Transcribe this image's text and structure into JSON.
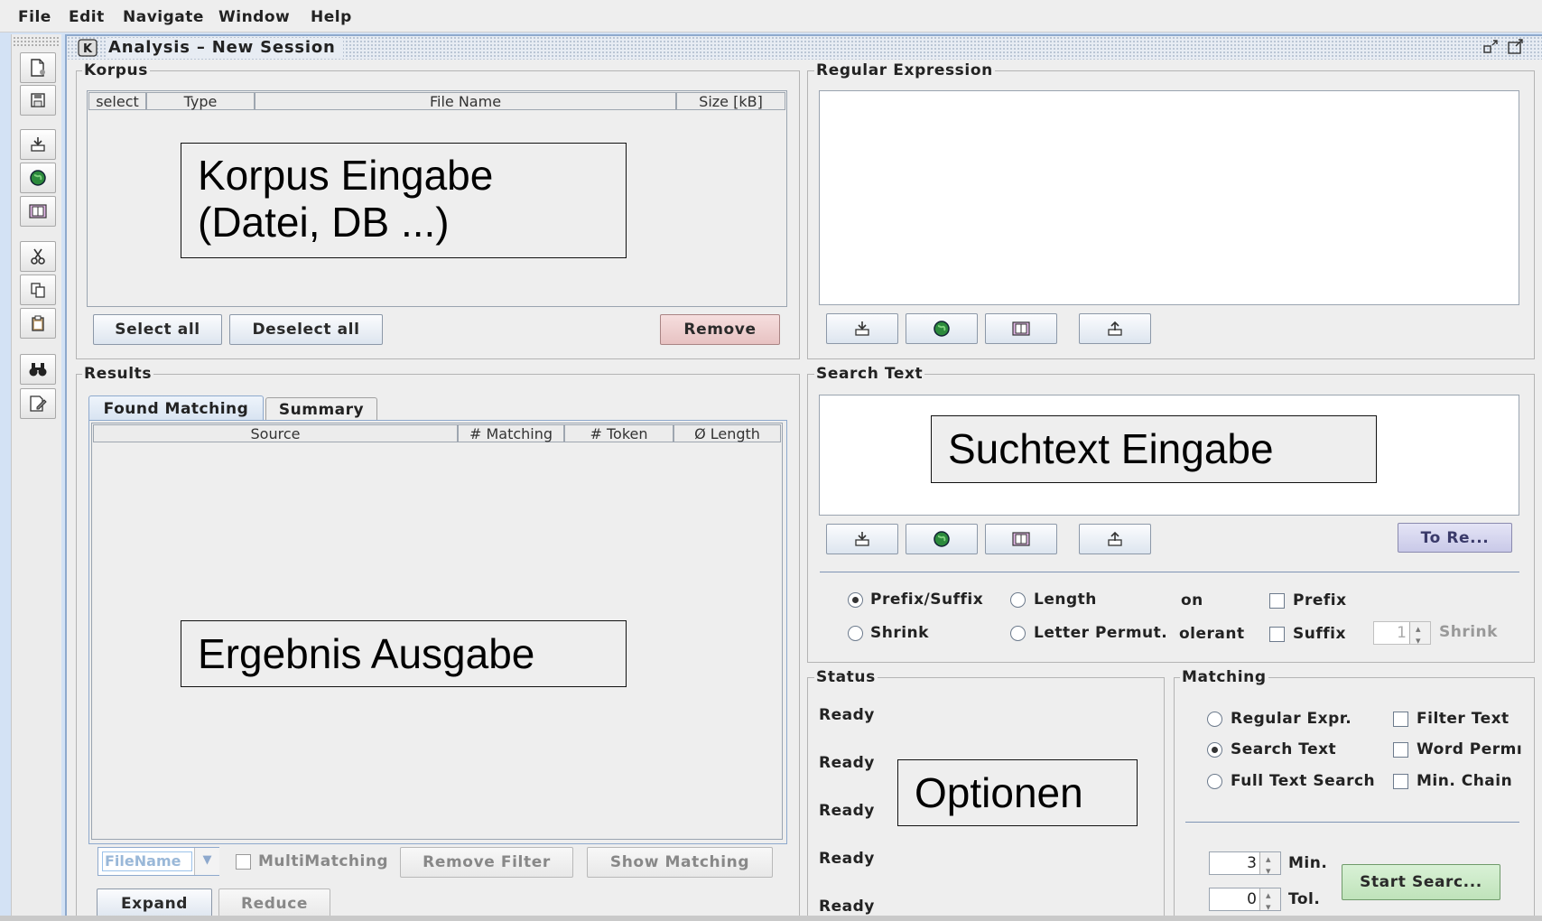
{
  "menu": [
    "File",
    "Edit",
    "Navigate",
    "Window",
    "Help"
  ],
  "toolbar_icons": [
    "new-document-icon",
    "save-icon",
    "import-icon",
    "globe-icon",
    "book-icon",
    "cut-icon",
    "copy-icon",
    "paste-icon",
    "binoculars-icon",
    "edit-icon"
  ],
  "window": {
    "title": "Analysis – New Session"
  },
  "korpus": {
    "title": "Korpus",
    "columns": [
      "select",
      "Type",
      "File Name",
      "Size [kB]"
    ],
    "annotation": [
      "Korpus Eingabe",
      "(Datei, DB ...)"
    ],
    "buttons": {
      "select_all": "Select all",
      "deselect_all": "Deselect all",
      "remove": "Remove"
    }
  },
  "regex": {
    "title": "Regular Expression"
  },
  "results": {
    "title": "Results",
    "tabs": [
      "Found Matching",
      "Summary"
    ],
    "columns": [
      "Source",
      "# Matching",
      "# Token",
      "Ø Length"
    ],
    "annotation": "Ergebnis Ausgabe",
    "filter_placeholder": "FileName",
    "multimatching": "MultiMatching",
    "remove_filter": "Remove Filter",
    "show_matching": "Show Matching",
    "expand": "Expand",
    "reduce": "Reduce"
  },
  "search": {
    "title": "Search Text",
    "annotation": "Suchtext Eingabe",
    "to_regex": "To Re...",
    "options": {
      "prefix_suffix": "Prefix/Suffix",
      "length": "Length",
      "on": "on",
      "prefix": "Prefix",
      "shrink": "Shrink",
      "letter_permut": "Letter Permut.",
      "olerant": "olerant",
      "suffix": "Suffix",
      "shrink_value": "1",
      "shrink_label": "Shrink"
    }
  },
  "status": {
    "title": "Status",
    "lines": [
      "Ready",
      "Ready",
      "Ready",
      "Ready",
      "Ready"
    ],
    "annotation": "Optionen"
  },
  "matching": {
    "title": "Matching",
    "regular_expr": "Regular Expr.",
    "search_text": "Search Text",
    "full_text": "Full Text Search",
    "filter_text": "Filter Text",
    "word_perm": "Word Permı",
    "min_chain": "Min. Chain",
    "min_value": "3",
    "min_label": "Min.",
    "tol_value": "0",
    "tol_label": "Tol.",
    "start": "Start Searc..."
  }
}
